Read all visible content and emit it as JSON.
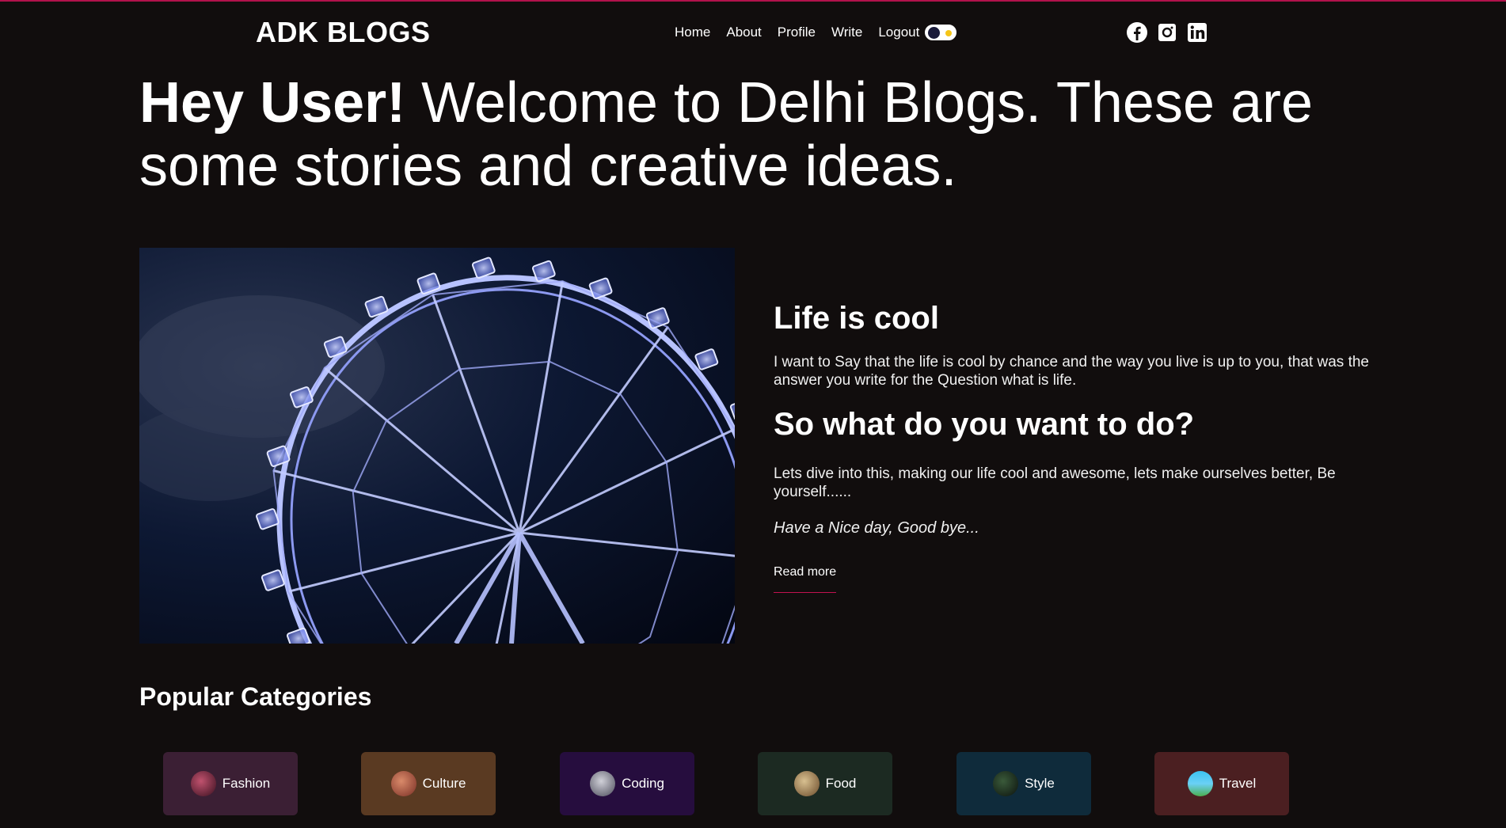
{
  "brand": "ADK BLOGS",
  "nav": {
    "items": [
      "Home",
      "About",
      "Profile",
      "Write",
      "Logout"
    ]
  },
  "theme_toggle": {
    "state": "dark"
  },
  "social": [
    "facebook-icon",
    "instagram-icon",
    "linkedin-icon"
  ],
  "hero": {
    "greeting": "Hey User!",
    "text": " Welcome to Delhi Blogs. These are some stories and creative ideas."
  },
  "post": {
    "title": "Life is cool",
    "paragraph1": "I want to Say that the life is cool by chance and the way you live is up to you, that was the answer you write for the Question what is life.",
    "subtitle": "So what do you want to do?",
    "paragraph2": "Lets dive into this, making our life cool and awesome, lets make ourselves better, Be yourself......",
    "signoff": "Have a Nice day, Good bye...",
    "read_more": "Read more"
  },
  "categories_title": "Popular Categories",
  "categories": [
    {
      "label": "Fashion",
      "bg": "#3b1f34"
    },
    {
      "label": "Culture",
      "bg": "#5a3a22"
    },
    {
      "label": "Coding",
      "bg": "#260d3e"
    },
    {
      "label": "Food",
      "bg": "#1c2a22"
    },
    {
      "label": "Style",
      "bg": "#0f2b3b"
    },
    {
      "label": "Travel",
      "bg": "#4b1f21"
    }
  ],
  "colors": {
    "background": "#110d0d",
    "accent": "#b1124c"
  }
}
